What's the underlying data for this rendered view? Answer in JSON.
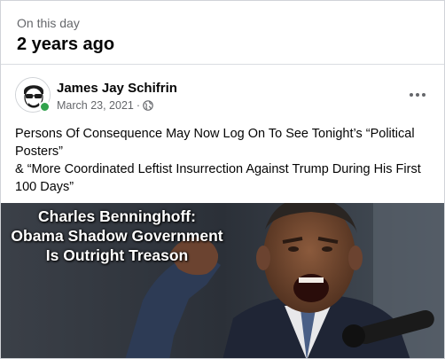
{
  "memory": {
    "kicker": "On this day",
    "title": "2 years ago"
  },
  "post": {
    "author": "James Jay Schifrin",
    "date": "March 23, 2021",
    "separator": "·",
    "privacy_icon": "globe-icon",
    "more_icon": "more-options-icon",
    "text_line_1": "Persons Of Consequence May Now Log On To See Tonight’s “Political Posters”",
    "text_line_2": "& “More Coordinated Leftist Insurrection Against Trump During His First 100 Days”"
  },
  "image": {
    "caption_line_1": "Charles Benninghoff:",
    "caption_line_2": "Obama Shadow Government",
    "caption_line_3": "Is Outright Treason"
  },
  "colors": {
    "online": "#31a24c",
    "secondary_text": "#65676b",
    "divider": "#dadde1"
  }
}
